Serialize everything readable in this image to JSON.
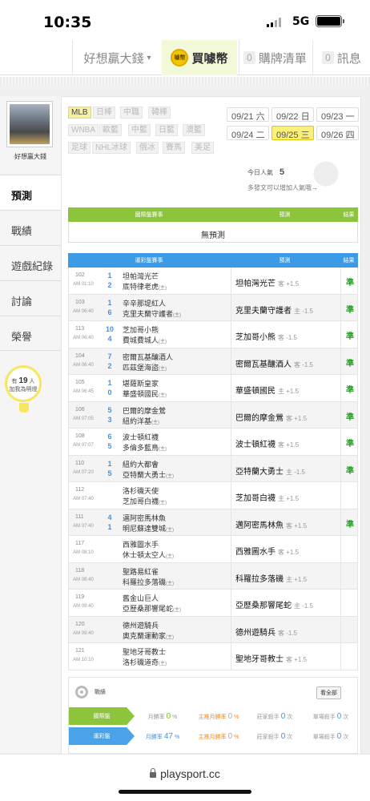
{
  "status": {
    "time": "10:35",
    "network": "5G"
  },
  "topnav": {
    "user": "好想贏大錢",
    "buy": "買噱幣",
    "coin_label": "噱幣",
    "cart_count": "0",
    "cart": "購牌清單",
    "msg_count": "0",
    "msg": "訊息"
  },
  "sidebar": {
    "username": "好想贏大錢",
    "items": [
      {
        "label": "預測"
      },
      {
        "label": "戰績"
      },
      {
        "label": "遊戲紀錄"
      },
      {
        "label": "討論"
      },
      {
        "label": "榮譽"
      }
    ],
    "bulb": {
      "prefix": "有",
      "count": "19",
      "unit": "人",
      "suffix": "加我為明燈"
    }
  },
  "leagues": [
    "MLB",
    "日棒",
    "中職",
    "韓棒",
    "WNBA",
    "歐籃",
    "中籃",
    "日籃",
    "澳籃",
    "足球",
    "NHL冰球",
    "俄冰",
    "賽馬",
    "美足"
  ],
  "active_league": "MLB",
  "dates": [
    "09/21 六",
    "09/22 日",
    "09/23 一",
    "09/24 二",
    "09/25 三",
    "09/26 四"
  ],
  "active_date": "09/25 三",
  "popularity": {
    "label": "今日人氣",
    "value": "5",
    "hint": "多發文可以增加人氣哦→"
  },
  "intl_table": {
    "col_game": "國際盤賽事",
    "col_pred": "預測",
    "col_result": "結果",
    "empty": "無預測"
  },
  "lottery_table": {
    "col_game": "運彩盤賽事",
    "col_pred": "預測",
    "col_result": "結果"
  },
  "games": [
    {
      "no": "102",
      "time": "AM 01:10",
      "a_score": "1",
      "h_score": "2",
      "away": "坦帕灣光芒",
      "home": "底特律老虎",
      "pick": "坦帕灣光芒",
      "side": "客",
      "line": "+1.5",
      "result": "準"
    },
    {
      "no": "103",
      "time": "AM 06:40",
      "a_score": "1",
      "h_score": "6",
      "away": "辛辛那堤紅人",
      "home": "克里夫蘭守護者",
      "pick": "克里夫蘭守護者",
      "side": "主",
      "line": "-1.5",
      "result": "準"
    },
    {
      "no": "113",
      "time": "AM 06:40",
      "a_score": "10",
      "h_score": "4",
      "away": "芝加哥小熊",
      "home": "費城費城人",
      "pick": "芝加哥小熊",
      "side": "客",
      "line": "-1.5",
      "result": "準"
    },
    {
      "no": "104",
      "time": "AM 06:40",
      "a_score": "7",
      "h_score": "2",
      "away": "密爾瓦基釀酒人",
      "home": "匹茲堡海盜",
      "pick": "密爾瓦基釀酒人",
      "side": "客",
      "line": "-1.5",
      "result": "準"
    },
    {
      "no": "105",
      "time": "AM 06:45",
      "a_score": "1",
      "h_score": "0",
      "away": "堪薩斯皇家",
      "home": "華盛頓國民",
      "pick": "華盛頓國民",
      "side": "主",
      "line": "+1.5",
      "result": "準"
    },
    {
      "no": "106",
      "time": "AM 07:05",
      "a_score": "5",
      "h_score": "3",
      "away": "巴爾的摩金鶯",
      "home": "紐約洋基",
      "pick": "巴爾的摩金鶯",
      "side": "客",
      "line": "+1.5",
      "result": "準"
    },
    {
      "no": "108",
      "time": "AM 07:07",
      "a_score": "6",
      "h_score": "5",
      "away": "波士頓紅襪",
      "home": "多倫多藍鳥",
      "pick": "波士頓紅襪",
      "side": "客",
      "line": "+1.5",
      "result": "準"
    },
    {
      "no": "110",
      "time": "AM 07:20",
      "a_score": "1",
      "h_score": "5",
      "away": "紐約大都會",
      "home": "亞特蘭大勇士",
      "pick": "亞特蘭大勇士",
      "side": "主",
      "line": "-1.5",
      "result": "準"
    },
    {
      "no": "112",
      "time": "AM 07:40",
      "a_score": "",
      "h_score": "",
      "away": "洛杉磯天使",
      "home": "芝加哥白襪",
      "pick": "芝加哥白襪",
      "side": "主",
      "line": "+1.5",
      "result": ""
    },
    {
      "no": "111",
      "time": "AM 07:40",
      "a_score": "4",
      "h_score": "1",
      "away": "邁阿密馬林魚",
      "home": "明尼蘇達雙城",
      "pick": "邁阿密馬林魚",
      "side": "客",
      "line": "+1.5",
      "result": "準"
    },
    {
      "no": "117",
      "time": "AM 08:10",
      "a_score": "",
      "h_score": "",
      "away": "西雅圖水手",
      "home": "休士頓太空人",
      "pick": "西雅圖水手",
      "side": "客",
      "line": "+1.5",
      "result": ""
    },
    {
      "no": "118",
      "time": "AM 08:40",
      "a_score": "",
      "h_score": "",
      "away": "聖路易紅雀",
      "home": "科羅拉多落磯",
      "pick": "科羅拉多落磯",
      "side": "主",
      "line": "+1.5",
      "result": ""
    },
    {
      "no": "119",
      "time": "AM 09:40",
      "a_score": "",
      "h_score": "",
      "away": "舊金山巨人",
      "home": "亞歷桑那響尾蛇",
      "pick": "亞歷桑那響尾蛇",
      "side": "主",
      "line": "-1.5",
      "result": ""
    },
    {
      "no": "120",
      "time": "AM 09:40",
      "a_score": "",
      "h_score": "",
      "away": "德州遊騎兵",
      "home": "奧克蘭運動家",
      "pick": "德州遊騎兵",
      "side": "客",
      "line": "-1.5",
      "result": ""
    },
    {
      "no": "121",
      "time": "AM 10:10",
      "a_score": "",
      "h_score": "",
      "away": "聖地牙哥教士",
      "home": "洛杉磯道奇",
      "pick": "聖地牙哥教士",
      "side": "客",
      "line": "+1.5",
      "result": ""
    }
  ],
  "home_mark": "(主)",
  "record": {
    "title": "戰績",
    "view_all": "看全部",
    "rows": [
      {
        "label": "國際盤",
        "c1": "月勝率",
        "v1": "0",
        "u1": "%",
        "c2": "主推月勝率",
        "v2": "0",
        "u2": "%",
        "c3": "莊家殺手",
        "v3": "0",
        "u3": "次",
        "c4": "單場殺手",
        "v4": "0",
        "u4": "次"
      },
      {
        "label": "運彩盤",
        "c1": "月勝率",
        "v1": "47",
        "u1": "%",
        "c2": "主推月勝率",
        "v2": "0",
        "u2": "%",
        "c3": "莊家殺手",
        "v3": "0",
        "u3": "次",
        "c4": "單場殺手",
        "v4": "0",
        "u4": "次"
      }
    ]
  },
  "browser": {
    "url": "playsport.cc"
  }
}
